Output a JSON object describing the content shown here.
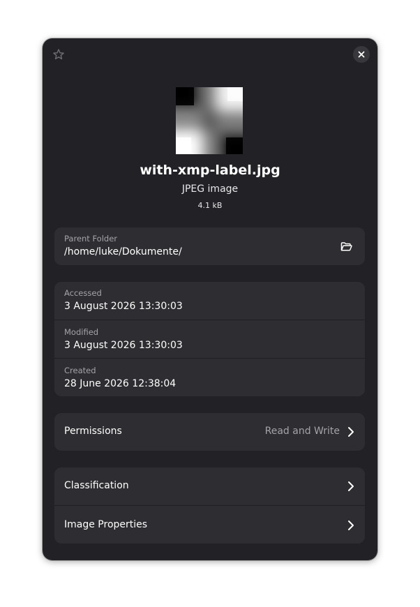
{
  "file": {
    "name": "with-xmp-label.jpg",
    "type": "JPEG image",
    "size": "4.1 kB"
  },
  "location": {
    "label": "Parent Folder",
    "path": "/home/luke/Dokumente/"
  },
  "dates": [
    {
      "label": "Accessed",
      "value": "3 August 2026 13:30:03"
    },
    {
      "label": "Modified",
      "value": "3 August 2026 13:30:03"
    },
    {
      "label": "Created",
      "value": "28 June 2026 12:38:04"
    }
  ],
  "permissions": {
    "label": "Permissions",
    "value": "Read and Write"
  },
  "extra": [
    {
      "label": "Classification"
    },
    {
      "label": "Image Properties"
    }
  ],
  "icons": {
    "star": "star-icon",
    "close": "close-icon",
    "folder": "folder-open-icon",
    "chevron": "chevron-right-icon"
  },
  "colors": {
    "window_bg": "#222226",
    "card_bg": "#2e2e32",
    "dim_text": "#a3a3a8"
  }
}
